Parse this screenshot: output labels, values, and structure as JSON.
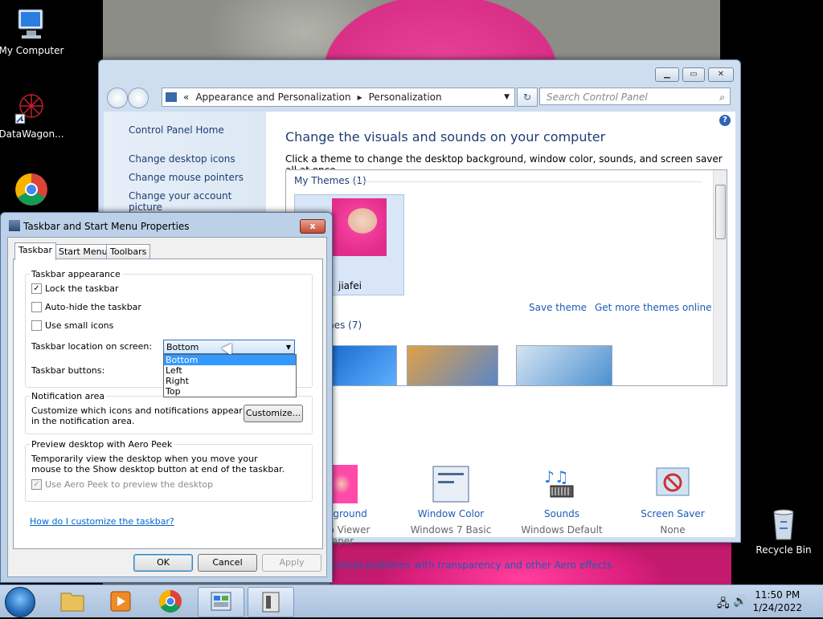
{
  "desktop": {
    "icons": [
      {
        "label": "My Computer",
        "icon": "computer-icon"
      },
      {
        "label": "DataWagon...",
        "icon": "datawagon-icon"
      },
      {
        "label": "",
        "icon": "chrome-shortcut-icon"
      },
      {
        "label": "Recycle Bin",
        "icon": "recycle-bin-icon"
      }
    ]
  },
  "control_panel": {
    "address": {
      "prefix": "«",
      "crumb1": "Appearance and Personalization",
      "crumb2": "Personalization"
    },
    "search_placeholder": "Search Control Panel",
    "left_links": {
      "home": "Control Panel Home",
      "desktop_icons": "Change desktop icons",
      "mouse_pointers": "Change mouse pointers",
      "account_picture": "Change your account picture"
    },
    "heading": "Change the visuals and sounds on your computer",
    "subheading": "Click a theme to change the desktop background, window color, sounds, and screen saver all at once.",
    "my_themes_label": "My Themes (1)",
    "theme_name": "jiafei",
    "save_theme": "Save theme",
    "get_more": "Get more themes online",
    "aero_label": "mes (7)",
    "bottom": [
      {
        "title": "Background",
        "sub": "Photo Viewer",
        "sub2": "lpaper"
      },
      {
        "title": "Window Color",
        "sub": "Windows 7 Basic"
      },
      {
        "title": "Sounds",
        "sub": "Windows Default"
      },
      {
        "title": "Screen Saver",
        "sub": "None"
      }
    ],
    "troubleshoot": "eshoot problems with transparency and other Aero effects"
  },
  "dialog": {
    "title": "Taskbar and Start Menu Properties",
    "close_label": "x",
    "tabs": [
      "Taskbar",
      "Start Menu",
      "Toolbars"
    ],
    "appearance_group": "Taskbar appearance",
    "lock_label": "Lock the taskbar",
    "lock_checked": true,
    "autohide_label": "Auto-hide the taskbar",
    "small_icons_label": "Use small icons",
    "location_label": "Taskbar location on screen:",
    "location_value": "Bottom",
    "location_options": [
      "Bottom",
      "Left",
      "Right",
      "Top"
    ],
    "buttons_label": "Taskbar buttons:",
    "notification_group": "Notification area",
    "notification_text": "Customize which icons and notifications appear in the notification area.",
    "customize_button": "Customize...",
    "peek_group": "Preview desktop with Aero Peek",
    "peek_text": "Temporarily view the desktop when you move your mouse to the Show desktop button at end of the taskbar.",
    "peek_checkbox": "Use Aero Peek to preview the desktop",
    "help_link": "How do I customize the taskbar?",
    "ok": "OK",
    "cancel": "Cancel",
    "apply": "Apply"
  },
  "taskbar": {
    "time": "11:50 PM",
    "date": "1/24/2022"
  }
}
